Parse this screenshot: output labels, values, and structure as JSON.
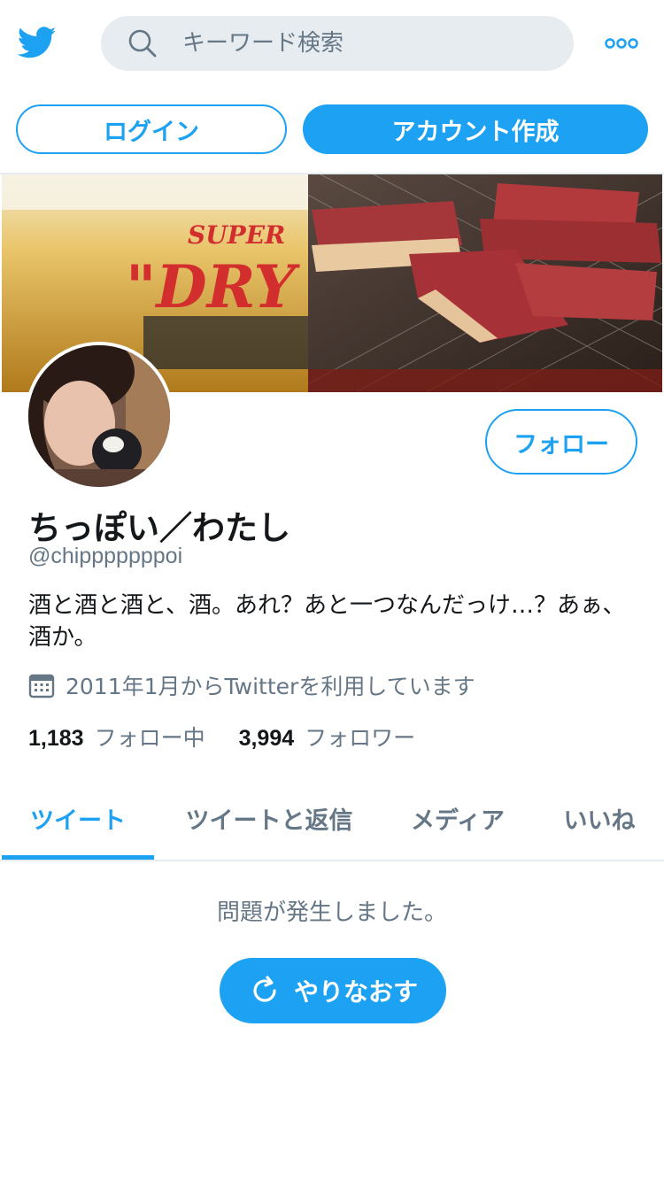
{
  "header": {
    "logo_icon": "twitter-bird-icon",
    "search": {
      "placeholder": "キーワード検索",
      "icon": "search-icon"
    },
    "more_icon": "more-dots-icon"
  },
  "auth": {
    "login_label": "ログイン",
    "signup_label": "アカウント作成"
  },
  "profile": {
    "follow_label": "フォロー",
    "display_name": "ちっぽい／わたし",
    "handle": "@chipppppppoi",
    "bio": "酒と酒と酒と、酒。あれ？あと一つなんだっけ…？あぁ、酒か。",
    "joined": "2011年1月からTwitterを利用しています",
    "stats": {
      "following_count": "1,183",
      "following_label": "フォロー中",
      "followers_count": "3,994",
      "followers_label": "フォロワー"
    }
  },
  "tabs": [
    {
      "label": "ツイート",
      "active": true
    },
    {
      "label": "ツイートと返信",
      "active": false
    },
    {
      "label": "メディア",
      "active": false
    },
    {
      "label": "いいね",
      "active": false
    }
  ],
  "timeline": {
    "error_message": "問題が発生しました。",
    "retry_label": "やりなおす"
  },
  "colors": {
    "accent": "#1da1f2",
    "secondary_text": "#657786",
    "search_bg": "#e6ecf0"
  }
}
